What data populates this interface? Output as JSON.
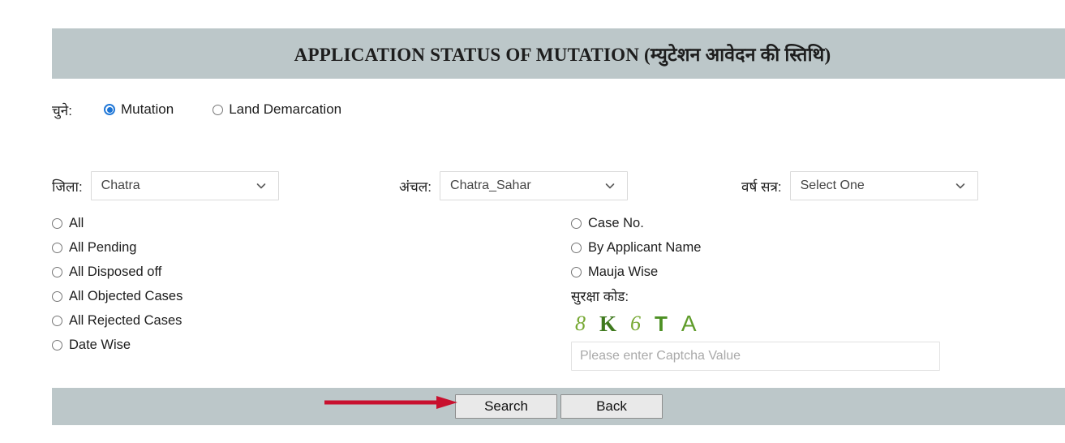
{
  "header": {
    "title": "APPLICATION STATUS OF MUTATION (म्युटेशन आवेदन की स्तिथि)",
    "background_color": "#bcc7c9"
  },
  "choose": {
    "label": "चुने:",
    "options": [
      {
        "label": "Mutation",
        "selected": true
      },
      {
        "label": "Land Demarcation",
        "selected": false
      }
    ]
  },
  "selects": [
    {
      "label": "जिला:",
      "value": "Chatra",
      "icon": "chevron-down-icon"
    },
    {
      "label": "अंचल:",
      "value": "Chatra_Sahar",
      "icon": "chevron-down-icon"
    },
    {
      "label": "वर्ष सत्र:",
      "value": "Select One",
      "icon": "chevron-down-icon"
    }
  ],
  "left_options": [
    {
      "label": "All",
      "selected": false
    },
    {
      "label": "All Pending",
      "selected": false
    },
    {
      "label": "All Disposed off",
      "selected": false
    },
    {
      "label": "All Objected Cases",
      "selected": false
    },
    {
      "label": "All Rejected Cases",
      "selected": false
    },
    {
      "label": "Date Wise",
      "selected": false
    }
  ],
  "right_options": [
    {
      "label": "Case No.",
      "selected": false
    },
    {
      "label": "By Applicant Name",
      "selected": false
    },
    {
      "label": "Mauja Wise",
      "selected": false
    }
  ],
  "captcha": {
    "label": "सुरक्षा कोड:",
    "characters": [
      "8",
      "K",
      "6",
      "T",
      "A"
    ],
    "text_color": "#4a8a26",
    "input_value": "",
    "input_placeholder": "Please enter Captcha Value"
  },
  "footer": {
    "search_label": "Search",
    "back_label": "Back",
    "background_color": "#bcc7c9"
  },
  "annotation": {
    "arrow_color": "#c8102e",
    "points_to": "Search"
  }
}
